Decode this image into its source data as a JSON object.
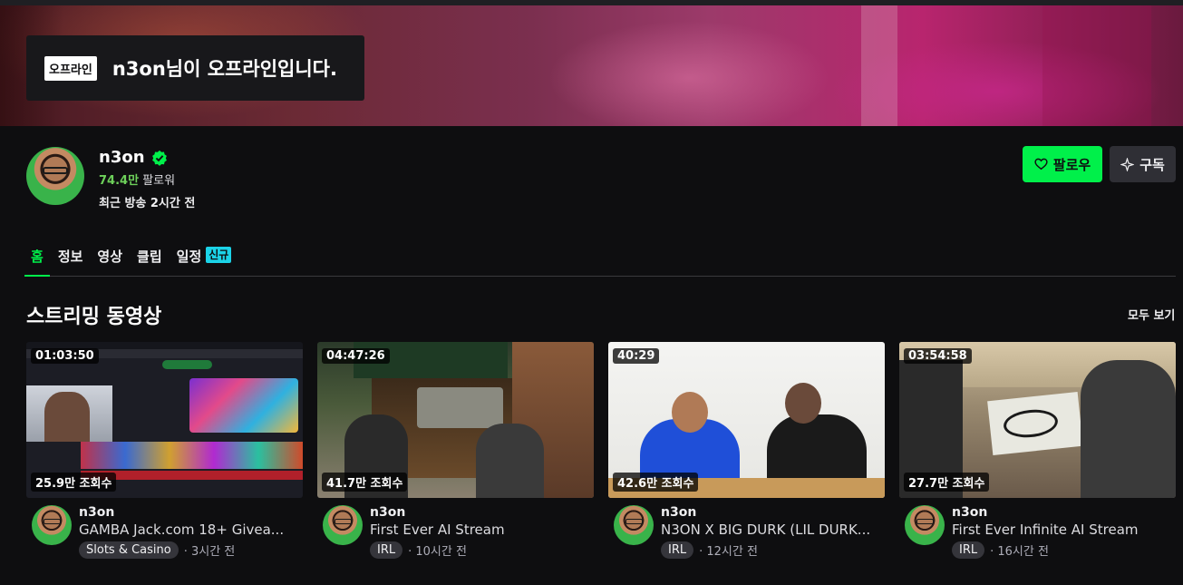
{
  "offline": {
    "tag": "오프라인",
    "message": "n3on님이 오프라인입니다."
  },
  "channel": {
    "name": "n3on",
    "followers_count": "74.4만",
    "followers_label": "팔로워",
    "last_live": "최근 방송 2시간 전"
  },
  "actions": {
    "follow": "팔로우",
    "subscribe": "구독"
  },
  "tabs": [
    {
      "label": "홈",
      "active": true
    },
    {
      "label": "정보"
    },
    {
      "label": "영상"
    },
    {
      "label": "클립"
    },
    {
      "label": "일정",
      "badge": "신규"
    }
  ],
  "section": {
    "title": "스트리밍 동영상",
    "see_all": "모두 보기"
  },
  "videos": [
    {
      "duration": "01:03:50",
      "views": "25.9만 조회수",
      "channel": "n3on",
      "title": "GAMBA Jack.com 18+ Givea...",
      "category": "Slots & Casino",
      "ago": "· 3시간 전"
    },
    {
      "duration": "04:47:26",
      "views": "41.7만 조회수",
      "channel": "n3on",
      "title": "First Ever AI Stream",
      "category": "IRL",
      "ago": "· 10시간 전"
    },
    {
      "duration": "40:29",
      "views": "42.6만 조회수",
      "channel": "n3on",
      "title": "N3ON X BIG DURK (LIL DURK...",
      "category": "IRL",
      "ago": "· 12시간 전"
    },
    {
      "duration": "03:54:58",
      "views": "27.7만 조회수",
      "channel": "n3on",
      "title": "First Ever Infinite AI Stream",
      "category": "IRL",
      "ago": "· 16시간 전"
    }
  ],
  "colors": {
    "accent": "#00f04a",
    "new_badge": "#1bd3e8",
    "verified": "#00f04a"
  }
}
